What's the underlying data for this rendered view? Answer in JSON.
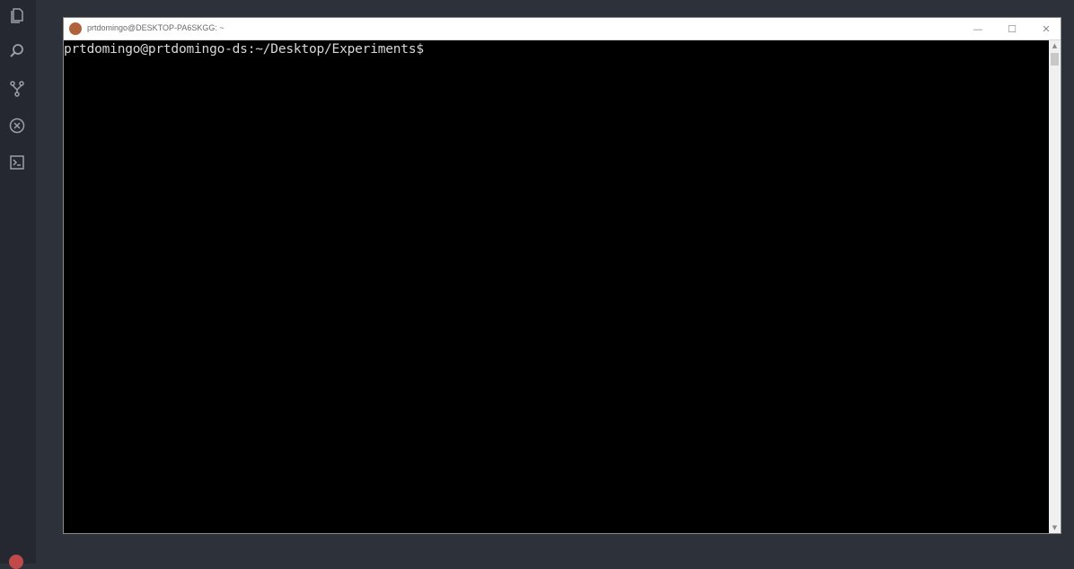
{
  "activity_bar": {
    "icons": [
      "files-icon",
      "search-icon",
      "source-control-icon",
      "extensions-icon",
      "terminal-icon"
    ]
  },
  "terminal": {
    "title": "prtdomingo@DESKTOP-PA6SKGG: ~",
    "window_controls": {
      "minimize": "—",
      "maximize": "☐",
      "close": "✕"
    },
    "prompt": "prtdomingo@prtdomingo-ds:~/Desktop/Experiments$"
  },
  "colors": {
    "background": "#2d313a",
    "activity_bar": "#252830",
    "terminal_bg": "#000000",
    "terminal_text": "#d8d8d8"
  }
}
